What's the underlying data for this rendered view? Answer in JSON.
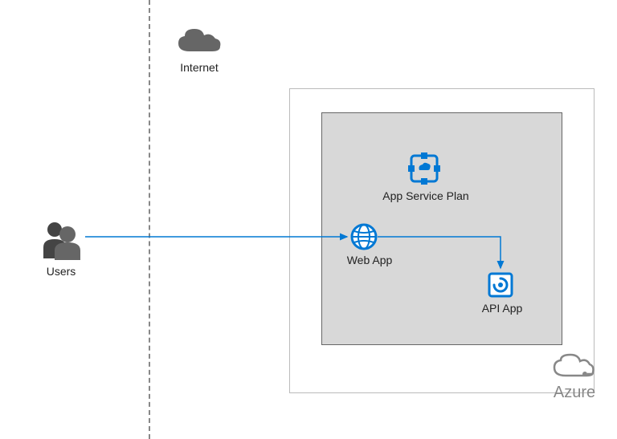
{
  "labels": {
    "users": "Users",
    "internet": "Internet",
    "azure": "Azure",
    "app_service_plan": "App Service Plan",
    "web_app": "Web App",
    "api_app": "API App"
  }
}
